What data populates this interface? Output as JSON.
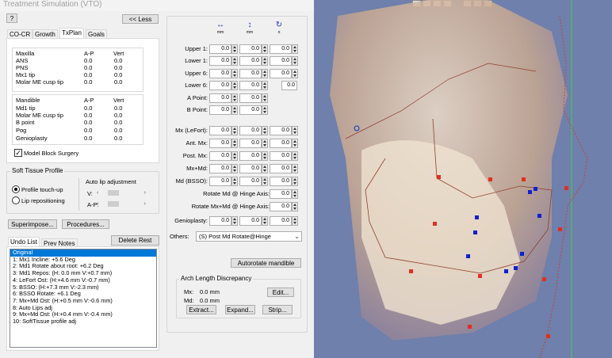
{
  "window_title": "Treatment Simulation (VTO)",
  "help_label": "?",
  "less_label": "<< Less",
  "tabs": [
    "CO-CR",
    "Growth",
    "TxPlan",
    "Goals"
  ],
  "maxilla": {
    "header": "Maxilla",
    "ap": "A-P",
    "vert": "Vert",
    "rows": [
      {
        "name": "ANS",
        "ap": "0.0",
        "vert": "0.0"
      },
      {
        "name": "PNS",
        "ap": "0.0",
        "vert": "0.0"
      },
      {
        "name": "Mx1 tip",
        "ap": "0.0",
        "vert": "0.0"
      },
      {
        "name": "Molar ME cusp tip",
        "ap": "0.0",
        "vert": "0.0"
      }
    ]
  },
  "mandible": {
    "header": "Mandible",
    "ap": "A-P",
    "vert": "Vert",
    "rows": [
      {
        "name": "Md1 tip",
        "ap": "0.0",
        "vert": "0.0"
      },
      {
        "name": "Molar ME cusp tip",
        "ap": "0.0",
        "vert": "0.0"
      },
      {
        "name": "B point",
        "ap": "0.0",
        "vert": "0.0"
      },
      {
        "name": "Pog",
        "ap": "0.0",
        "vert": "0.0"
      },
      {
        "name": "Genioplasty",
        "ap": "0.0",
        "vert": "0.0"
      }
    ]
  },
  "model_block_label": "Model Block Surgery",
  "soft_tissue": {
    "title": "Soft Tissue Profile",
    "opt1": "Profile touch-up",
    "opt2": "Lip repositioning",
    "auto_lip": "Auto lip adjustment",
    "v": "V:",
    "ap": "A-P:"
  },
  "superimpose_label": "Superimpose...",
  "procedures_label": "Procedures...",
  "undo_tab": "Undo List",
  "prev_notes_tab": "Prev Notes",
  "delete_rest_label": "Delete Rest",
  "undo_items": [
    "Original",
    "1:  Mx1 Incline: +5.6 Deg",
    "2:  Md1 Rotate about root: +6.2 Deg",
    "3:  Md1 Repos: (H: 0.0 mm V:+0.7 mm)",
    "4:  LeFort Ost: (H:+4.6 mm V:-0.7 mm)",
    "5:  BSSO: (H:+7.3 mm V:-2.3 mm)",
    "6:  BSSO Rotate: +6.1 Deg",
    "7:  Mx+Md Ost: (H:+0.5 mm V:-0.6 mm)",
    "8:  Auto Lips adj",
    "9:  Mx+Md Ost: (H:+0.4 mm V:-0.4 mm)",
    "10:  SoftTissue profile adj"
  ],
  "units": {
    "mm1": "mm",
    "mm2": "mm",
    "deg": "o"
  },
  "teeth": [
    {
      "label": "Upper 1:",
      "h": "0.0",
      "v": "0.0",
      "r": "0.0"
    },
    {
      "label": "Lower 1:",
      "h": "0.0",
      "v": "0.0",
      "r": "0.0"
    },
    {
      "label": "Upper 6:",
      "h": "0.0",
      "v": "0.0",
      "r": "0.0"
    },
    {
      "label": "Lower 6:",
      "h": "0.0",
      "v": "0.0",
      "r": "0.0"
    }
  ],
  "a_point": {
    "label": "A Point:",
    "h": "0.0",
    "v": "0.0"
  },
  "b_point": {
    "label": "B Point:",
    "h": "0.0",
    "v": "0.0"
  },
  "surg": [
    {
      "label": "Mx (LeFort):",
      "h": "0.0",
      "v": "0.0",
      "r": "0.0"
    },
    {
      "label": "Ant. Mx:",
      "h": "0.0",
      "v": "0.0",
      "r": "0.0"
    },
    {
      "label": "Post. Mx:",
      "h": "0.0",
      "v": "0.0",
      "r": "0.0"
    },
    {
      "label": "Mx+Md:",
      "h": "0.0",
      "v": "0.0",
      "r": "0.0"
    },
    {
      "label": "Md (BSSO):",
      "h": "0.0",
      "v": "0.0",
      "r": "0.0"
    }
  ],
  "rotate_md_label": "Rotate Md @ Hinge Axis:",
  "rotate_md_val": "0.0",
  "rotate_mxmd_label": "Rotate Mx+Md @ Hinge Axis:",
  "rotate_mxmd_val": "0.0",
  "genioplasty": {
    "label": "Genioplasty:",
    "h": "0.0",
    "v": "0.0",
    "r": "0.0"
  },
  "others_label": "Others:",
  "others_value": "(S) Post Md Rotate@Hinge",
  "autorotate_label": "Autorotate mandible",
  "arch": {
    "title": "Arch Length Discrepancy",
    "mx": "Mx:",
    "mx_val": "0.0 mm",
    "md": "Md:",
    "md_val": "0.0 mm",
    "edit": "Edit...",
    "extract": "Extract...",
    "expand": "Expand...",
    "strip": "Strip..."
  },
  "colors": {
    "selection": "#0078d7",
    "landmark_red": "#e03020",
    "landmark_blue": "#1020d0",
    "trace": "#e86040"
  }
}
